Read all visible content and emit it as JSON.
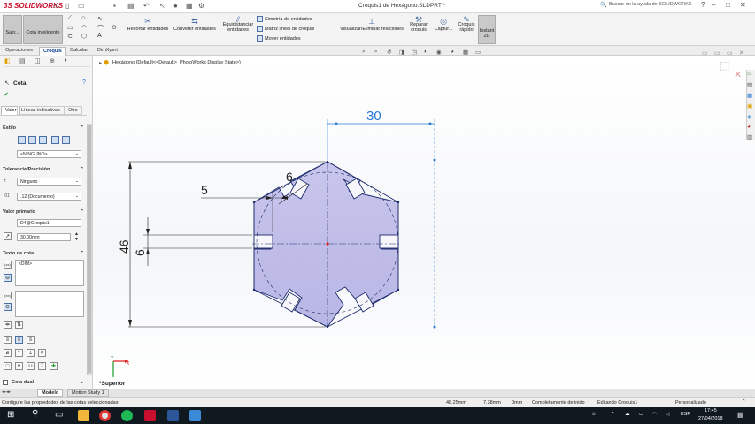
{
  "app": {
    "logo_text": "SOLIDWORKS",
    "logo_prefix": "3S",
    "document_title": "Croquis1 de Hexágono.SLDPRT *",
    "help_search_placeholder": "Buscar en la ayuda de SOLIDWORKS",
    "window_controls": [
      "?",
      "–",
      "□",
      "✕"
    ]
  },
  "command_manager": {
    "big_buttons": [
      "Salir...",
      "Cota inteligente"
    ],
    "tools_right_big": [
      "Croquis rápido",
      "Instant 2D"
    ],
    "items": {
      "recortar": "Recortar entidades",
      "convertir": "Convertir entidades",
      "equidistanciar": "Equidistanciar entidades",
      "simetria": "Simetría de entidades",
      "matriz": "Matriz lineal de croquis",
      "mover": "Mover entidades",
      "visualizar": "Visualizar/Eliminar relaciones",
      "reparar": "Reparar croquis",
      "captura": "Captur..."
    }
  },
  "tabs": [
    "Operaciones",
    "Croquis",
    "Calcular",
    "DimXpert"
  ],
  "active_tab": "Croquis",
  "breadcrumb": "Hexágono  (Default<<Default>_PhotoWorks Display State>)",
  "property_manager": {
    "title": "Cota",
    "subtabs": [
      "Valor",
      "Líneas indicativas",
      "Otro"
    ],
    "estilo": {
      "label": "Estilo",
      "selected": "<NINGUNO>"
    },
    "tolerancia": {
      "label": "Tolerancia/Precisión",
      "tolerance": "Ninguno",
      "precision": ".12 (Documento)"
    },
    "valor_primario": {
      "label": "Valor primario",
      "name": "D4@Croquis1",
      "value": "30.00mm"
    },
    "texto_cota": {
      "label": "Texto de cota",
      "text": "<DIM>"
    },
    "cota_dual": "Cota dual"
  },
  "bottom_tabs": [
    "Modelo",
    "Motion Study 1"
  ],
  "active_bottom_tab": "Modelo",
  "view_label": "*Superior",
  "dimensions": {
    "top": "30",
    "left_total": "46",
    "slot_height": "6",
    "slot_depth": "5",
    "slot_width_angled": "6"
  },
  "status_bar": {
    "message": "Configure las propiedades de las cotas seleccionadas.",
    "x": "48.25mm",
    "y": "7.38mm",
    "z": "0mm",
    "state": "Completamente definido",
    "editing": "Editando Croquis1",
    "units": "Personalizado"
  },
  "taskbar": {
    "time": "17:45",
    "date": "27/04/2018",
    "language": "ESP"
  },
  "colors": {
    "accent": "#1f78d1",
    "hex_fill": "#c9c9ef",
    "dimension": "#2a7bd4",
    "taskbar": "#101820"
  }
}
